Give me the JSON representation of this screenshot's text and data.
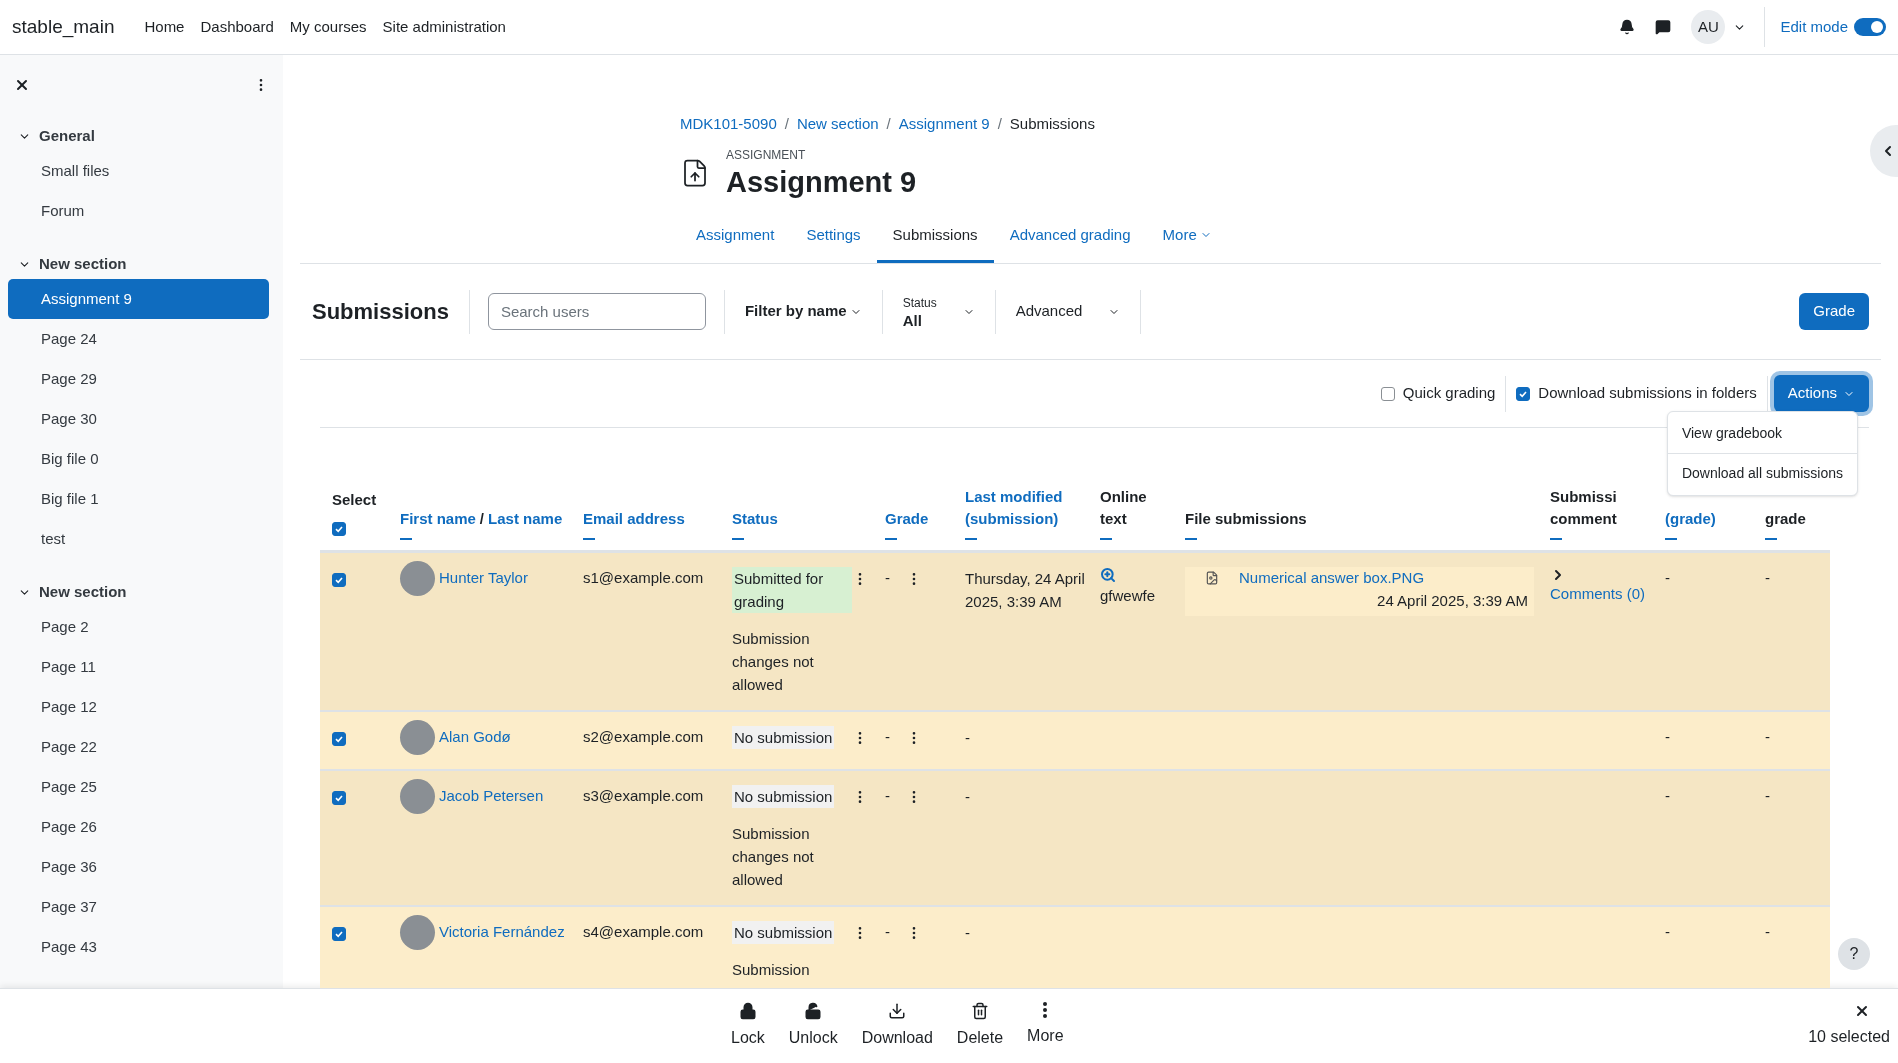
{
  "navbar": {
    "brand": "stable_main",
    "links": [
      "Home",
      "Dashboard",
      "My courses",
      "Site administration"
    ],
    "avatar": "AU",
    "edit_mode": {
      "label": "Edit mode",
      "on": true
    }
  },
  "sidebar": {
    "sections": [
      {
        "title": "General",
        "expanded": true,
        "items": [
          {
            "label": "Small files",
            "selected": false
          },
          {
            "label": "Forum",
            "selected": false
          }
        ]
      },
      {
        "title": "New section",
        "expanded": true,
        "items": [
          {
            "label": "Assignment 9",
            "selected": true
          },
          {
            "label": "Page 24",
            "selected": false
          },
          {
            "label": "Page 29",
            "selected": false
          },
          {
            "label": "Page 30",
            "selected": false
          },
          {
            "label": "Big file 0",
            "selected": false
          },
          {
            "label": "Big file 1",
            "selected": false
          },
          {
            "label": "test",
            "selected": false
          }
        ]
      },
      {
        "title": "New section",
        "expanded": true,
        "items": [
          {
            "label": "Page 2",
            "selected": false
          },
          {
            "label": "Page 11",
            "selected": false
          },
          {
            "label": "Page 12",
            "selected": false
          },
          {
            "label": "Page 22",
            "selected": false
          },
          {
            "label": "Page 25",
            "selected": false
          },
          {
            "label": "Page 26",
            "selected": false
          },
          {
            "label": "Page 36",
            "selected": false
          },
          {
            "label": "Page 37",
            "selected": false
          },
          {
            "label": "Page 43",
            "selected": false
          }
        ]
      }
    ]
  },
  "breadcrumb": [
    "MDK101-5090",
    "New section",
    "Assignment 9",
    "Submissions"
  ],
  "breadcrumb_separator": "/",
  "header": {
    "kicker": "ASSIGNMENT",
    "title": "Assignment 9"
  },
  "tabs": [
    {
      "label": "Assignment",
      "selected": false
    },
    {
      "label": "Settings",
      "selected": false
    },
    {
      "label": "Submissions",
      "selected": true
    },
    {
      "label": "Advanced grading",
      "selected": false
    },
    {
      "label": "More",
      "selected": false
    }
  ],
  "toolbar": {
    "title": "Submissions",
    "search_placeholder": "Search users",
    "filter": "Filter by name",
    "status_label": "Status",
    "status_value": "All",
    "advanced": "Advanced",
    "grade_button": "Grade"
  },
  "options": {
    "quick_grading": {
      "label": "Quick grading",
      "checked": false
    },
    "download_in_folders": {
      "label": "Download submissions in folders",
      "checked": true
    },
    "actions": "Actions"
  },
  "actions_menu": [
    "View gradebook",
    "Download all submissions"
  ],
  "table": {
    "select_label": "Select",
    "select_all": true,
    "columns": [
      {
        "kind": "name",
        "first": "First name",
        "separator": "/",
        "last": "Last name"
      },
      {
        "kind": "link",
        "label": "Email address"
      },
      {
        "kind": "link",
        "label": "Status"
      },
      {
        "kind": "link",
        "label": "Grade"
      },
      {
        "kind": "link",
        "label": "Last modified (submission)"
      },
      {
        "kind": "plain",
        "label": "Online text"
      },
      {
        "kind": "plain",
        "label": "File submissions"
      },
      {
        "kind": "plain",
        "label": "Submissi comment"
      },
      {
        "kind": "link",
        "label": "(grade)"
      },
      {
        "kind": "plain",
        "label": "grade"
      }
    ],
    "rows": [
      {
        "selected": true,
        "name": "Hunter Taylor",
        "email": "s1@example.com",
        "status": "Submitted for grading",
        "submitted": true,
        "note": "Submission changes not allowed",
        "grade": "-",
        "modified": "Thursday, 24 April 2025, 3:39 AM",
        "online_text": "gfwewfe",
        "file": "Numerical answer box.PNG",
        "file_date": "24 April 2025, 3:39 AM",
        "comments": "Comments (0)",
        "modified_grade": "-",
        "final_grade": "-"
      },
      {
        "selected": true,
        "name": "Alan Godø",
        "email": "s2@example.com",
        "status": "No submission",
        "submitted": false,
        "grade": "-",
        "modified": "-",
        "modified_grade": "-",
        "final_grade": "-"
      },
      {
        "selected": true,
        "name": "Jacob Petersen",
        "email": "s3@example.com",
        "status": "No submission",
        "submitted": false,
        "note": "Submission changes not allowed",
        "grade": "-",
        "modified": "-",
        "modified_grade": "-",
        "final_grade": "-"
      },
      {
        "selected": true,
        "name": "Victoria Fernández",
        "email": "s4@example.com",
        "status": "No submission",
        "submitted": false,
        "note": "Submission",
        "grade": "-",
        "modified": "-",
        "modified_grade": "-",
        "final_grade": "-"
      }
    ]
  },
  "bulk_bar": {
    "actions": [
      {
        "kind": "lock",
        "label": "Lock"
      },
      {
        "kind": "unlock",
        "label": "Unlock"
      },
      {
        "kind": "download",
        "label": "Download"
      },
      {
        "kind": "delete",
        "label": "Delete"
      },
      {
        "kind": "more",
        "label": "More"
      }
    ],
    "count": "10 selected"
  },
  "help": "?"
}
